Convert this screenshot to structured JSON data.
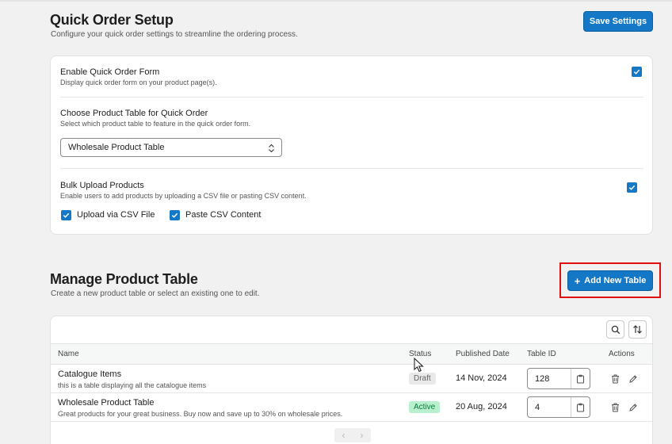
{
  "setup": {
    "title": "Quick Order Setup",
    "subtitle": "Configure your quick order settings to streamline the ordering process.",
    "save_label": "Save Settings",
    "enable": {
      "label": "Enable Quick Order Form",
      "desc": "Display quick order form on your product page(s).",
      "checked": true
    },
    "choose": {
      "label": "Choose Product Table for Quick Order",
      "desc": "Select which product table to feature in the quick order form.",
      "selected": "Wholesale Product Table"
    },
    "bulk": {
      "label": "Bulk Upload Products",
      "desc": "Enable users to add products by uploading a CSV file or pasting CSV content.",
      "checked": true,
      "options": [
        {
          "label": "Upload via CSV File",
          "checked": true
        },
        {
          "label": "Paste CSV Content",
          "checked": true
        }
      ]
    }
  },
  "manage": {
    "title": "Manage Product Table",
    "subtitle": "Create a new product table or select an existing one to edit.",
    "add_label": "Add New Table",
    "add_icon": "+"
  },
  "table": {
    "columns": {
      "name": "Name",
      "status": "Status",
      "published": "Published Date",
      "table_id": "Table ID",
      "actions": "Actions"
    },
    "rows": [
      {
        "name": "Catalogue Items",
        "desc": "this is a table displaying all the catalogue items",
        "status": "Draft",
        "date": "14 Nov, 2024",
        "id": "128"
      },
      {
        "name": "Wholesale Product Table",
        "desc": "Great products for your great business. Buy now and save up to 30% on wholesale prices.",
        "status": "Active",
        "date": "20 Aug, 2024",
        "id": "4"
      }
    ],
    "pager_prev": "‹",
    "pager_next": "›"
  },
  "colors": {
    "accent": "#1578c6",
    "draft_bg": "#e9e9e9",
    "active_bg": "#b8f0cf",
    "highlight": "#e01010"
  }
}
